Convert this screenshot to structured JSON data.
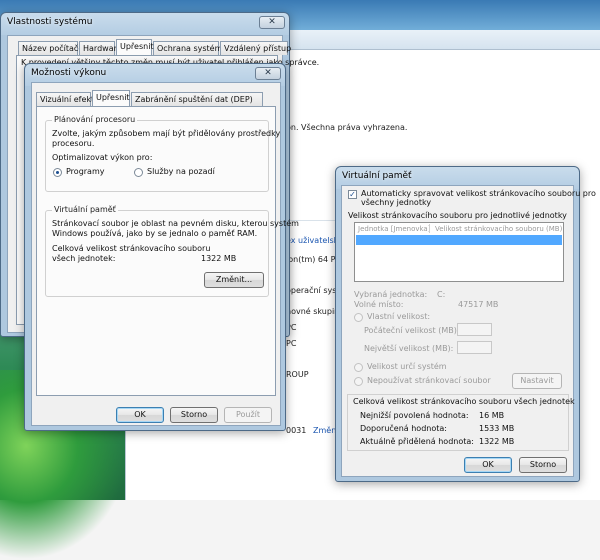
{
  "background_window": {
    "copyright_text": "on. Všechna práva vyhrazena.",
    "link_fragment": "ex uživatelsk",
    "processor_fragment": "lon(tm) 64 Pr",
    "os_fragment": "operační systém",
    "group_fragment": "novné skupiny",
    "pc1": "PC",
    "pc2": "PC",
    "group_value": "ROUP",
    "product_id_fragment": "0031",
    "change_link": "Změni"
  },
  "system_props": {
    "title": "Vlastnosti systému",
    "close_glyph": "✕",
    "tabs": [
      "Název počítače",
      "Hardware",
      "Upřesnit",
      "Ochrana systému",
      "Vzdálený přístup"
    ],
    "notice": "K provedení většiny těchto změn musí být uživatel přihlášen jako správce."
  },
  "performance": {
    "title": "Možnosti výkonu",
    "close_glyph": "✕",
    "tabs": [
      "Vizuální efekty",
      "Upřesnit",
      "Zabránění spuštění dat (DEP)"
    ],
    "cpu_group_title": "Plánování procesoru",
    "cpu_description": [
      "Zvolte, jakým způsobem mají být přidělovány prostředky",
      "procesoru."
    ],
    "optimize_label": "Optimalizovat výkon pro:",
    "radio_programs": "Programy",
    "radio_services": "Služby na pozadí",
    "vm_group_title": "Virtuální paměť",
    "vm_description": [
      "Stránkovací soubor je oblast na pevném disku, kterou systém",
      "Windows používá, jako by se jednalo o paměť RAM."
    ],
    "total_size_label": [
      "Celková velikost stránkovacího souboru",
      "všech jednotek:"
    ],
    "total_size_value": "1322 MB",
    "change_button": "Změnit...",
    "ok_button": "OK",
    "cancel_button": "Storno",
    "apply_button": "Použít"
  },
  "virtual_memory": {
    "title": "Virtuální paměť",
    "auto_manage_label": [
      "Automaticky spravovat velikost stránkovacího souboru pro",
      "všechny jednotky"
    ],
    "auto_manage_checked": true,
    "per_drive_heading": "Velikost stránkovacího souboru pro jednotlivé jednotky",
    "col_drive": "Jednotka [Jmenovka]",
    "col_size": "Velikost stránkovacího souboru (MB)",
    "selected_drive_label": "Vybraná jednotka:",
    "selected_drive_value": "C:",
    "free_space_label": "Volné místo:",
    "free_space_value": "47517 MB",
    "custom_size_label": "Vlastní velikost:",
    "initial_size_label": "Počáteční velikost (MB):",
    "max_size_label": "Největší velikost (MB):",
    "system_managed_label": "Velikost určí systém",
    "no_paging_label": "Nepoužívat stránkovací soubor",
    "set_button": "Nastavit",
    "totals_heading": "Celková velikost stránkovacího souboru všech jednotek",
    "min_allowed_label": "Nejnižší povolená hodnota:",
    "min_allowed_value": "16 MB",
    "recommended_label": "Doporučená hodnota:",
    "recommended_value": "1533 MB",
    "current_label": "Aktuálně přidělená hodnota:",
    "current_value": "1322 MB",
    "ok_button": "OK",
    "cancel_button": "Storno"
  }
}
